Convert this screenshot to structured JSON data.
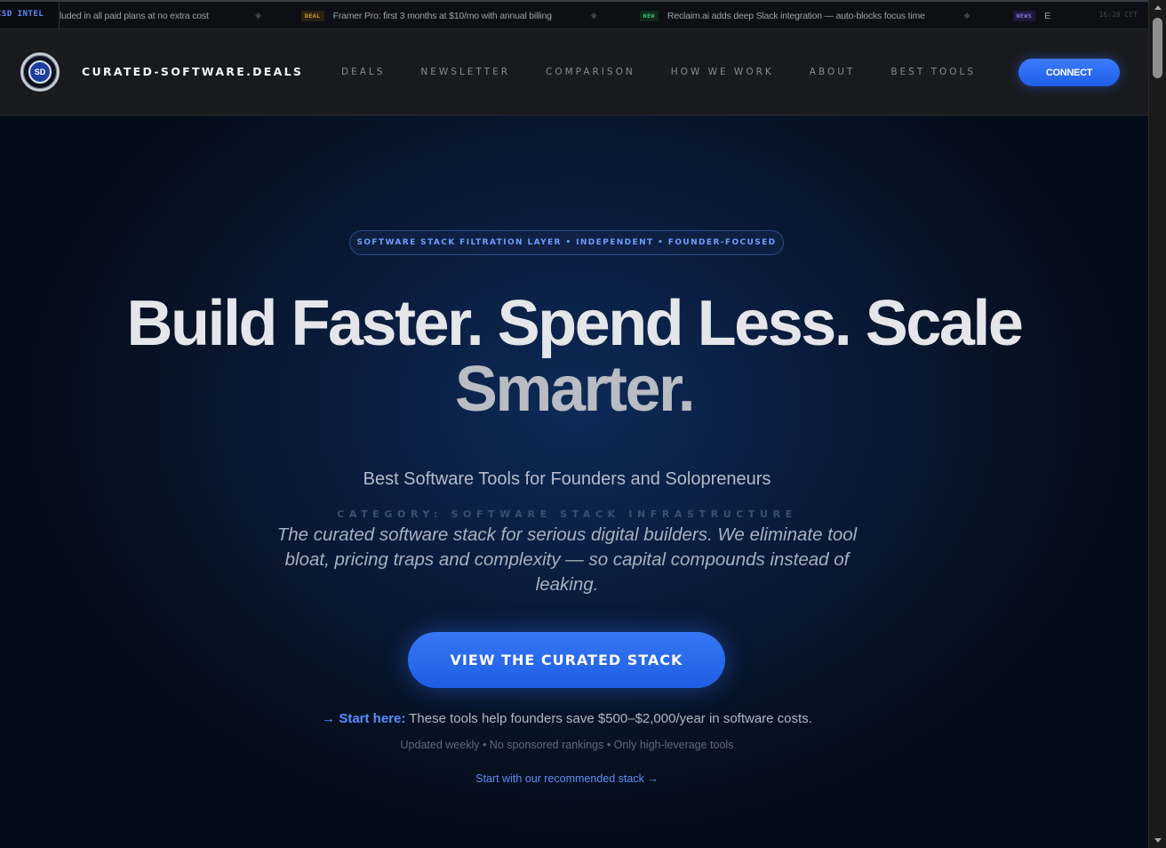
{
  "ticker": {
    "brand": "CSD INTEL",
    "items": [
      {
        "tag": "",
        "text": "luded in all paid plans at no extra cost"
      },
      {
        "tag": "DEAL",
        "text": "Framer Pro: first 3 months at $10/mo with annual billing"
      },
      {
        "tag": "NEW",
        "text": "Reclaim.ai adds deep Slack integration — auto-blocks focus time"
      },
      {
        "tag": "NEWS",
        "text": "E"
      }
    ],
    "separator": "◆",
    "time": "16:28 CET"
  },
  "nav": {
    "logo_letters": "SD",
    "brand": "CURATED-SOFTWARE.DEALS",
    "links": [
      "DEALS",
      "NEWSLETTER",
      "COMPARISON",
      "HOW WE WORK",
      "ABOUT",
      "BEST TOOLS"
    ],
    "connect_label": "CONNECT"
  },
  "hero": {
    "pill": "SOFTWARE STACK FILTRATION LAYER • INDEPENDENT • FOUNDER-FOCUSED",
    "headline_line1": "Build Faster. Spend Less. Scale",
    "headline_line2": "Smarter.",
    "subtitle": "Best Software Tools for Founders and Solopreneurs",
    "category": "CATEGORY: SOFTWARE STACK INFRASTRUCTURE",
    "description": "The curated software stack for serious digital builders. We eliminate tool bloat, pricing traps and complexity — so capital compounds instead of leaking.",
    "cta_label": "VIEW THE CURATED STACK",
    "start_arrow": "→",
    "start_strong": "Start here:",
    "start_text": " These tools help founders save $500–$2,000/year in software costs.",
    "meta": "Updated weekly • No sponsored rankings • Only high-leverage tools",
    "recommended_link": "Start with our recommended stack →"
  },
  "colors": {
    "accent": "#3577f5",
    "background": "#071327",
    "nav_background": "#191a1d"
  }
}
